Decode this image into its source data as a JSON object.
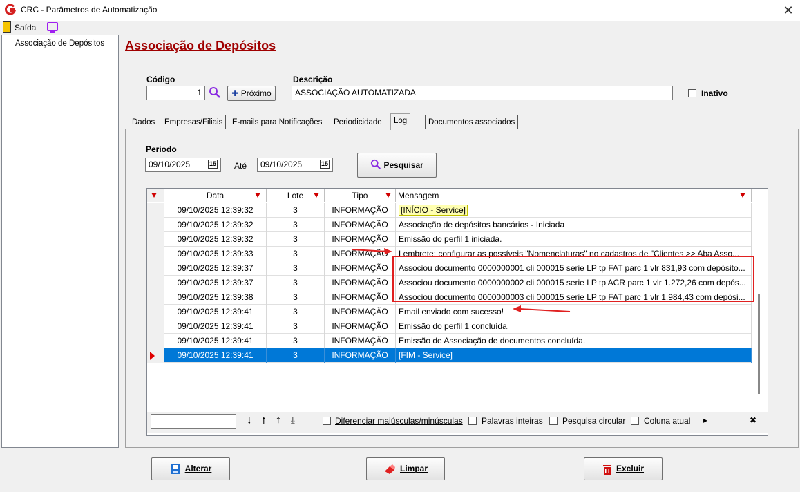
{
  "window": {
    "title": "CRC - Parâmetros de Automatização",
    "close_glyph": "✕"
  },
  "menubar": {
    "exit_label": "Saída"
  },
  "tree": {
    "items": [
      "Associação de Depósitos"
    ]
  },
  "page": {
    "title": "Associação de Depósitos"
  },
  "form": {
    "codigo_label": "Código",
    "codigo_value": "1",
    "proximo_label": "Próximo",
    "descricao_label": "Descrição",
    "descricao_value": "ASSOCIAÇÃO AUTOMATIZADA",
    "inativo_label": "Inativo"
  },
  "tabs": [
    {
      "label": "Dados"
    },
    {
      "label": "Empresas/Filiais"
    },
    {
      "label": "E-mails para Notificações"
    },
    {
      "label": "Periodicidade"
    },
    {
      "label": "Log"
    },
    {
      "label": "Documentos associados"
    }
  ],
  "active_tab": "Log",
  "log": {
    "periodo_label": "Período",
    "from_date": "09/10/2025",
    "ate_label": "Até",
    "to_date": "09/10/2025",
    "calendar_glyph": "15",
    "pesquisar_label": "Pesquisar",
    "columns": [
      "Data",
      "Lote",
      "Tipo",
      "Mensagem"
    ],
    "rows": [
      {
        "data": "09/10/2025 12:39:32",
        "lote": "3",
        "tipo": "INFORMAÇÃO",
        "mensagem": "[INÍCIO - Service]"
      },
      {
        "data": "09/10/2025 12:39:32",
        "lote": "3",
        "tipo": "INFORMAÇÃO",
        "mensagem": "Associação de depósitos bancários - Iniciada"
      },
      {
        "data": "09/10/2025 12:39:32",
        "lote": "3",
        "tipo": "INFORMAÇÃO",
        "mensagem": "Emissão do perfil 1 iniciada."
      },
      {
        "data": "09/10/2025 12:39:33",
        "lote": "3",
        "tipo": "INFORMAÇÃO",
        "mensagem": "Lembrete: configurar as possíveis \"Nomenclaturas\" no cadastros de \"Clientes >> Aba Asso..."
      },
      {
        "data": "09/10/2025 12:39:37",
        "lote": "3",
        "tipo": "INFORMAÇÃO",
        "mensagem": "Associou documento 0000000001 cli 000015 serie LP tp FAT parc 1 vlr 831,93 com depósito..."
      },
      {
        "data": "09/10/2025 12:39:37",
        "lote": "3",
        "tipo": "INFORMAÇÃO",
        "mensagem": "Associou documento 0000000002 cli 000015 serie LP tp ACR parc 1 vlr 1.272,26 com depós..."
      },
      {
        "data": "09/10/2025 12:39:38",
        "lote": "3",
        "tipo": "INFORMAÇÃO",
        "mensagem": "Associou documento 0000000003 cli 000015 serie LP tp FAT parc 1 vlr 1.984,43 com depósi..."
      },
      {
        "data": "09/10/2025 12:39:41",
        "lote": "3",
        "tipo": "INFORMAÇÃO",
        "mensagem": "Email enviado com sucesso!"
      },
      {
        "data": "09/10/2025 12:39:41",
        "lote": "3",
        "tipo": "INFORMAÇÃO",
        "mensagem": "Emissão do perfil 1 concluída."
      },
      {
        "data": "09/10/2025 12:39:41",
        "lote": "3",
        "tipo": "INFORMAÇÃO",
        "mensagem": "Emissão de Associação de documentos concluída."
      },
      {
        "data": "09/10/2025 12:39:41",
        "lote": "3",
        "tipo": "INFORMAÇÃO",
        "mensagem": "[FIM - Service]"
      }
    ],
    "selected_row": 10
  },
  "findbar": {
    "diferenciar_label": "Diferenciar maiúsculas/minúsculas",
    "palavras_label": "Palavras inteiras",
    "circular_label": "Pesquisa circular",
    "coluna_label": "Coluna atual",
    "down_glyph": "🠗",
    "up_glyph": "🠕",
    "first_glyph": "⤒",
    "last_glyph": "⤓",
    "more_glyph": "▸",
    "clear_glyph": "✖"
  },
  "actions": {
    "alterar_label": "Alterar",
    "limpar_label": "Limpar",
    "excluir_label": "Excluir"
  },
  "colors": {
    "accent": "#0078d7",
    "title": "#a00000",
    "annotation": "#e02020"
  }
}
